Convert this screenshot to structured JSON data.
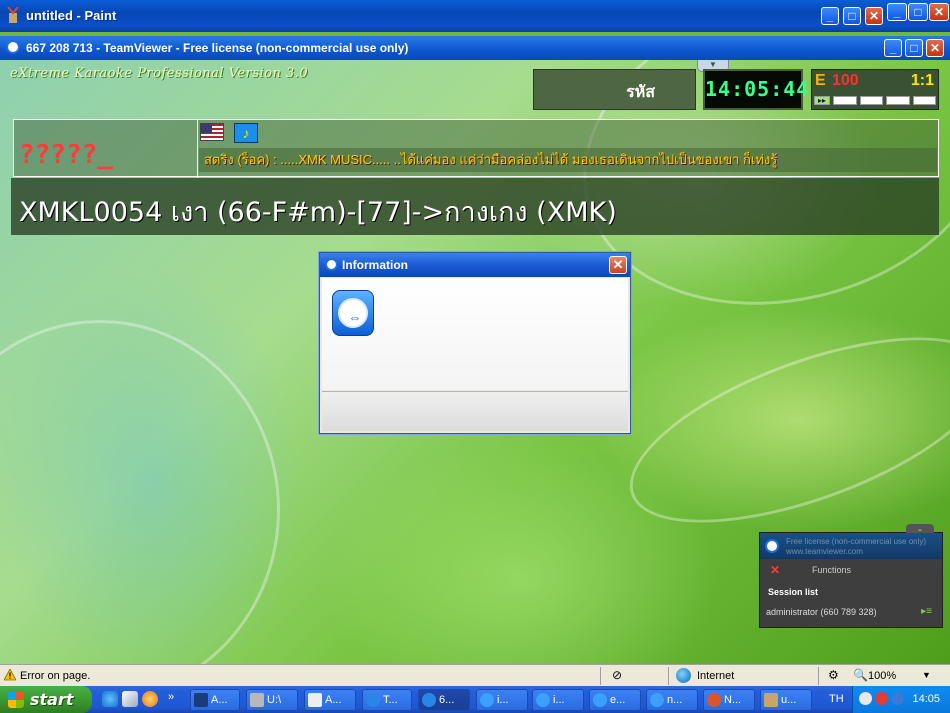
{
  "paint_window": {
    "title": "untitled - Paint",
    "buttons": [
      "_",
      "□",
      "✕"
    ]
  },
  "teamviewer_window": {
    "title": "667 208 713 - TeamViewer - Free license (non-commercial use only)"
  },
  "karaoke": {
    "brand": "eXtreme Karaoke Professional Version 3.0",
    "code_label": "รหัส",
    "clock": "14:05:44",
    "status_e": "E",
    "volume": "100",
    "ratio": "1:1",
    "question_marks": "?????_",
    "ticker": "สตริง (ร็อค) : .....XMK MUSIC..... ..ได้แค่มอง แค่ว่ามือคล่องไม่ได้ มองเธอเดินจากไปเป็นของเขา ก็เท่งรู้",
    "song_title": "XMKL0054 เงา (66-F#m)-[77]->กางเกง (XMK)"
  },
  "dialog": {
    "title": "Information"
  },
  "tv_panel": {
    "line1": "Free license (non-commercial use only)",
    "line2": "www.teamviewer.com",
    "functions": "Functions",
    "session_list": "Session list",
    "session_row": "administrator (660 789 328)"
  },
  "ie_status": {
    "error_text": "Error on page.",
    "zone": "Internet",
    "zoom": "100%"
  },
  "taskbar": {
    "start": "start",
    "tasks": [
      "A...",
      "U:\\",
      "A...",
      "T...",
      "6...",
      "i...",
      "i...",
      "e...",
      "n...",
      "N...",
      "u..."
    ],
    "lang": "TH",
    "time": "14:05"
  }
}
